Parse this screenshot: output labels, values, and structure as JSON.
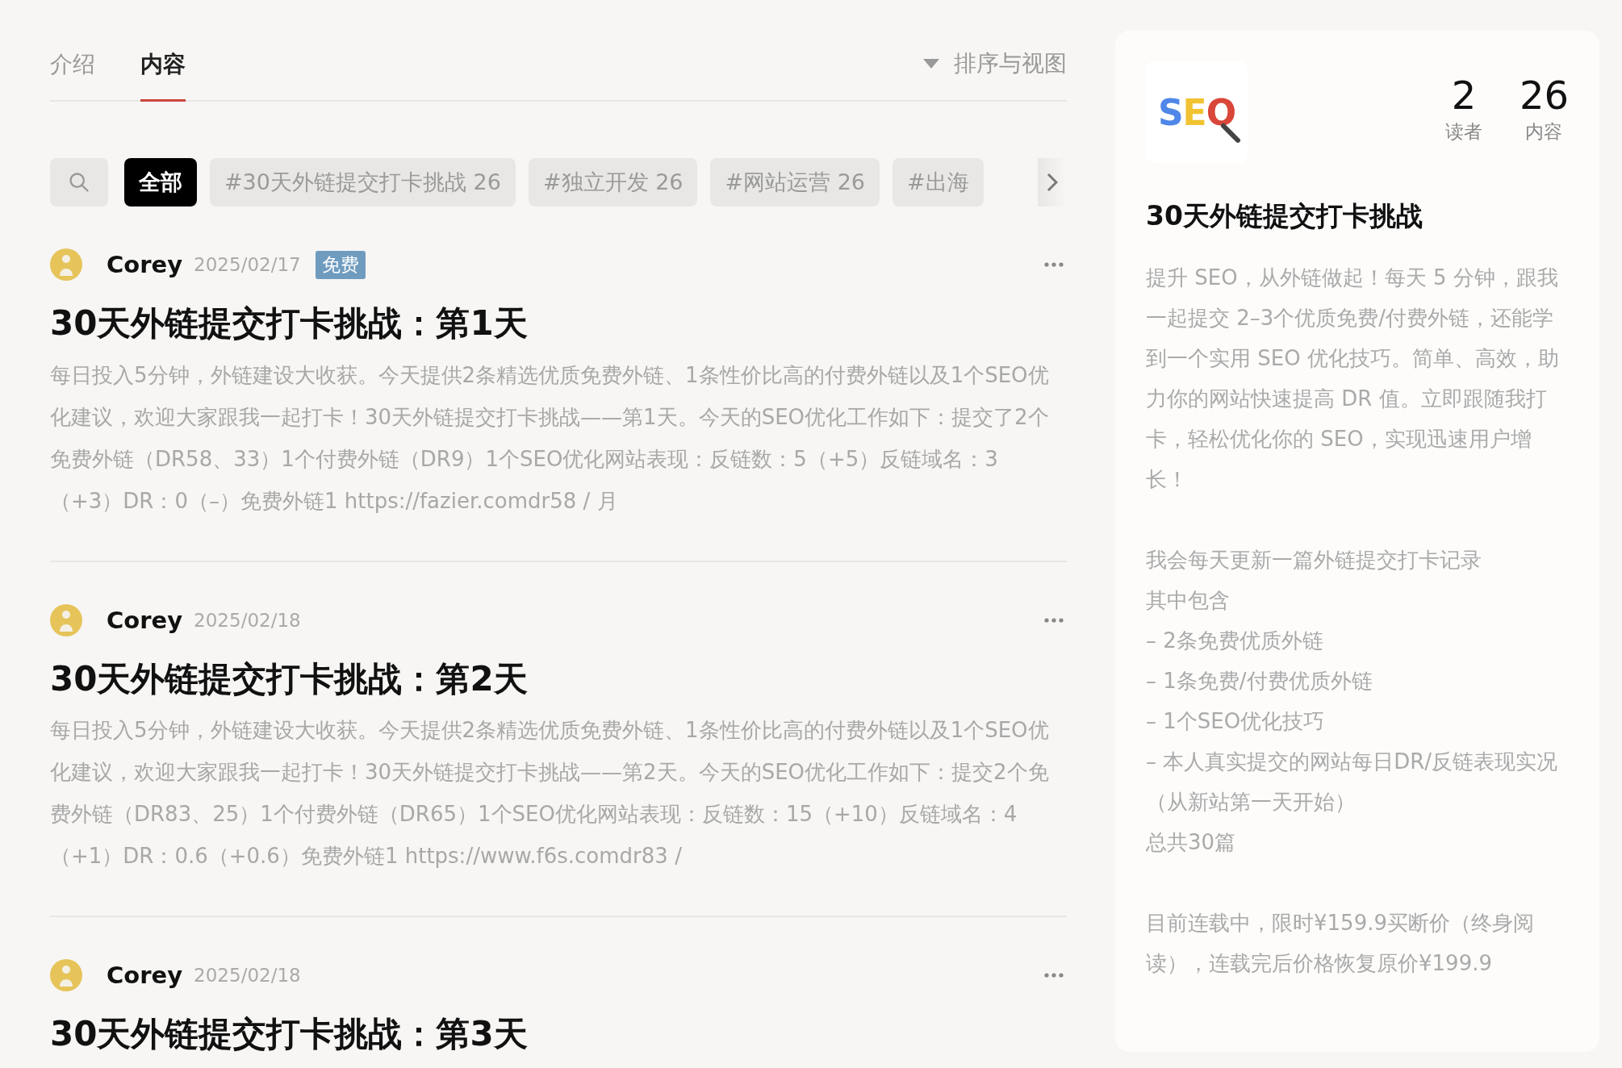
{
  "tabs": [
    {
      "label": "介绍",
      "selected": false
    },
    {
      "label": "内容",
      "selected": true
    }
  ],
  "sort_button": {
    "label": "排序与视图"
  },
  "filters": [
    {
      "label": "全部",
      "selected": true
    },
    {
      "label": "#30天外链提交打卡挑战 26",
      "selected": false
    },
    {
      "label": "#独立开发 26",
      "selected": false
    },
    {
      "label": "#网站运营 26",
      "selected": false
    },
    {
      "label": "#出海",
      "selected": false
    }
  ],
  "posts": [
    {
      "author": "Corey",
      "date": "2025/02/17",
      "badge": "免费",
      "title": "30天外链提交打卡挑战：第1天",
      "excerpt": "每日投入5分钟，外链建设大收获。今天提供2条精选优质免费外链、1条性价比高的付费外链以及1个SEO优化建议，欢迎大家跟我一起打卡！30天外链提交打卡挑战——第1天。今天的SEO优化工作如下：提交了2个免费外链（DR58、33）1个付费外链（DR9）1个SEO优化网站表现：反链数：5（+5）反链域名：3（+3）DR：0（–）免费外链1 https://fazier.comdr58 /   月"
    },
    {
      "author": "Corey",
      "date": "2025/02/18",
      "title": "30天外链提交打卡挑战：第2天",
      "excerpt": "每日投入5分钟，外链建设大收获。今天提供2条精选优质免费外链、1条性价比高的付费外链以及1个SEO优化建议，欢迎大家跟我一起打卡！30天外链提交打卡挑战——第2天。今天的SEO优化工作如下：提交2个免费外链（DR83、25）1个付费外链（DR65）1个SEO优化网站表现：反链数：15（+10）反链域名：4（+1）DR：0.6（+0.6）免费外链1 https://www.f6s.comdr83 /"
    },
    {
      "author": "Corey",
      "date": "2025/02/18",
      "title": "30天外链提交打卡挑战：第3天"
    }
  ],
  "sidebar": {
    "logo_text": "SEO",
    "stats": [
      {
        "value": "2",
        "label": "读者"
      },
      {
        "value": "26",
        "label": "内容"
      }
    ],
    "title": "30天外链提交打卡挑战",
    "description": "提升 SEO，从外链做起！每天 5 分钟，跟我一起提交 2–3个优质免费/付费外链，还能学到一个实用 SEO 优化技巧。简单、高效，助力你的网站快速提高 DR 值。立即跟随我打卡，轻松优化你的 SEO，实现迅速用户增长！",
    "details": [
      "我会每天更新一篇外链提交打卡记录",
      "其中包含",
      "– 2条免费优质外链",
      "– 1条免费/付费优质外链",
      "– 1个SEO优化技巧",
      "– 本人真实提交的网站每日DR/反链表现实况（从新站第一天开始）",
      "总共30篇"
    ],
    "price_note": "目前连载中，限时¥159.9买断价（终身阅读），连载完后价格恢复原价¥199.9"
  }
}
